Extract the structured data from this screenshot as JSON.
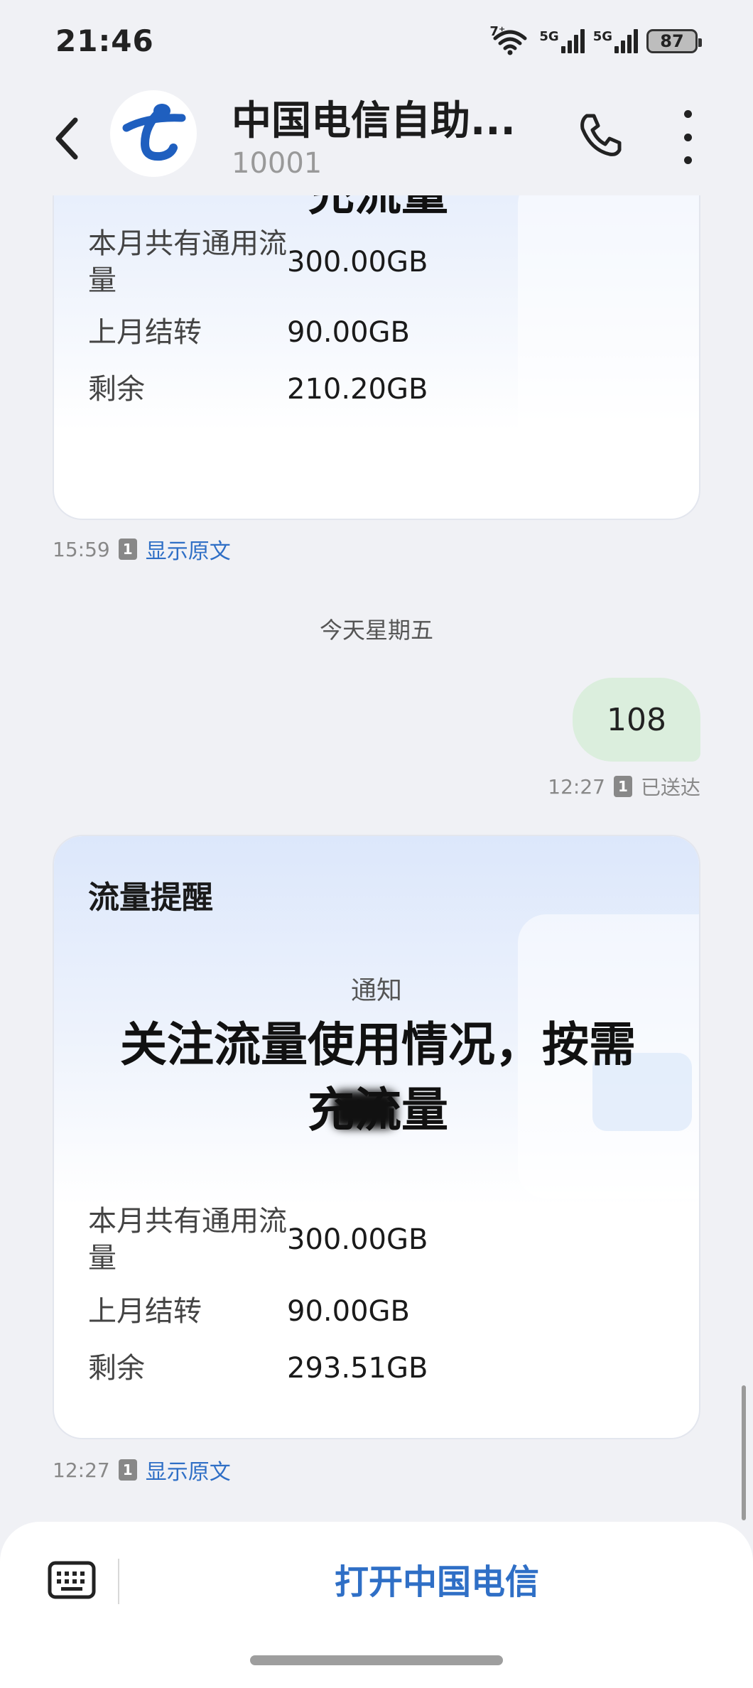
{
  "status_bar": {
    "time": "21:46",
    "network_label_1": "7⁺",
    "sim1_label": "5G",
    "sim2_label": "5G",
    "battery_level": "87"
  },
  "header": {
    "contact_name": "中国电信自助...",
    "contact_number": "10001"
  },
  "messages": {
    "card1": {
      "headline_tail": "充流量",
      "rows": [
        {
          "label": "本月共有通用流量",
          "value": "300.00GB"
        },
        {
          "label": "上月结转",
          "value": "90.00GB"
        },
        {
          "label": "剩余",
          "value": "210.20GB"
        }
      ],
      "time": "15:59",
      "sim": "1",
      "link": "显示原文"
    },
    "date_separator": "今天星期五",
    "sent": {
      "text": "108",
      "time": "12:27",
      "sim": "1",
      "status": "已送达"
    },
    "card2": {
      "title": "流量提醒",
      "subtitle": "通知",
      "headline_line1": "关注流量使用情况，按需",
      "headline_line2": "充流量",
      "rows": [
        {
          "label": "本月共有通用流量",
          "value": "300.00GB"
        },
        {
          "label": "上月结转",
          "value": "90.00GB"
        },
        {
          "label": "剩余",
          "value": "293.51GB"
        }
      ],
      "time": "12:27",
      "sim": "1",
      "link": "显示原文"
    }
  },
  "bottom": {
    "open_button": "打开中国电信"
  },
  "colors": {
    "accent_blue": "#2f6fc6",
    "telecom_blue": "#1f5fbf",
    "sent_bubble": "#dbeedd",
    "background": "#f0f1f5"
  }
}
